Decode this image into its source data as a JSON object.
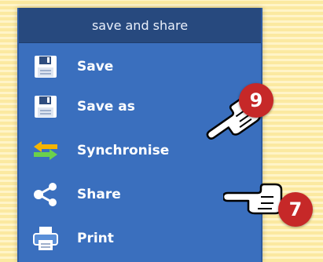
{
  "panel": {
    "title": "save and share",
    "items": [
      {
        "label": "Save",
        "icon": "floppy-disk-icon"
      },
      {
        "label": "Save as",
        "icon": "floppy-disk-icon"
      },
      {
        "label": "Synchronise",
        "icon": "sync-arrows-icon"
      },
      {
        "label": "Share",
        "icon": "share-icon"
      },
      {
        "label": "Print",
        "icon": "printer-icon"
      }
    ]
  },
  "callouts": [
    {
      "number": "9",
      "points_to": "Save as"
    },
    {
      "number": "7",
      "points_to": "Share"
    }
  ],
  "colors": {
    "panel_bg": "#3a6fbe",
    "header_bg": "#27497e",
    "badge": "#c62828",
    "background_stripes": "#fbe9a0"
  }
}
